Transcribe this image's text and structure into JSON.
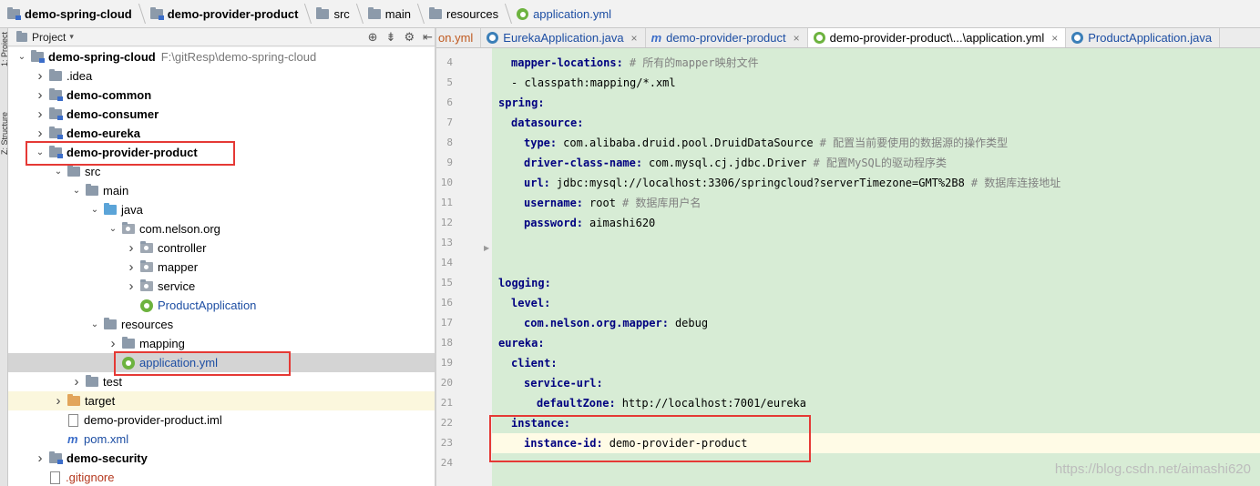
{
  "breadcrumb": [
    {
      "label": "demo-spring-cloud",
      "style": "bold"
    },
    {
      "label": "demo-provider-product",
      "style": "bold"
    },
    {
      "label": "src",
      "style": ""
    },
    {
      "label": "main",
      "style": ""
    },
    {
      "label": "resources",
      "style": ""
    },
    {
      "label": "application.yml",
      "style": "blue"
    }
  ],
  "tool_strip": {
    "project_tab": "1: Project",
    "structure_tab": "Z: Structure"
  },
  "project_panel": {
    "title": "Project"
  },
  "tree": [
    {
      "label": "demo-spring-cloud",
      "path": "F:\\gitResp\\demo-spring-cloud",
      "depth": 0,
      "expanded": true,
      "icon": "module-folder",
      "bold": true
    },
    {
      "label": ".idea",
      "depth": 1,
      "expanded": false,
      "icon": "folder"
    },
    {
      "label": "demo-common",
      "depth": 1,
      "expanded": false,
      "icon": "module-folder",
      "bold": true
    },
    {
      "label": "demo-consumer",
      "depth": 1,
      "expanded": false,
      "icon": "module-folder",
      "bold": true
    },
    {
      "label": "demo-eureka",
      "depth": 1,
      "expanded": false,
      "icon": "module-folder",
      "bold": true
    },
    {
      "label": "demo-provider-product",
      "depth": 1,
      "expanded": true,
      "icon": "module-folder",
      "bold": true
    },
    {
      "label": "src",
      "depth": 2,
      "expanded": true,
      "icon": "folder"
    },
    {
      "label": "main",
      "depth": 3,
      "expanded": true,
      "icon": "folder"
    },
    {
      "label": "java",
      "depth": 4,
      "expanded": true,
      "icon": "source-folder"
    },
    {
      "label": "com.nelson.org",
      "depth": 5,
      "expanded": true,
      "icon": "package"
    },
    {
      "label": "controller",
      "depth": 6,
      "expanded": false,
      "icon": "package"
    },
    {
      "label": "mapper",
      "depth": 6,
      "expanded": false,
      "icon": "package"
    },
    {
      "label": "service",
      "depth": 6,
      "expanded": false,
      "icon": "package"
    },
    {
      "label": "ProductApplication",
      "depth": 6,
      "icon": "spring-class",
      "color": "blue"
    },
    {
      "label": "resources",
      "depth": 4,
      "expanded": true,
      "icon": "folder"
    },
    {
      "label": "mapping",
      "depth": 5,
      "expanded": false,
      "icon": "folder"
    },
    {
      "label": "application.yml",
      "depth": 5,
      "icon": "spring-yml",
      "color": "blue",
      "selected": true
    },
    {
      "label": "test",
      "depth": 3,
      "expanded": false,
      "icon": "folder"
    },
    {
      "label": "target",
      "depth": 2,
      "expanded": false,
      "icon": "excluded-folder",
      "highlight": true
    },
    {
      "label": "demo-provider-product.iml",
      "depth": 2,
      "icon": "file"
    },
    {
      "label": "pom.xml",
      "depth": 2,
      "icon": "maven",
      "color": "blue"
    },
    {
      "label": "demo-security",
      "depth": 1,
      "expanded": false,
      "icon": "module-folder",
      "bold": true
    },
    {
      "label": ".gitignore",
      "depth": 1,
      "icon": "file",
      "color": "red"
    }
  ],
  "editor_tabs": [
    {
      "label": "on.yml",
      "icon": "",
      "cut": true
    },
    {
      "label": "EurekaApplication.java",
      "icon": "class",
      "close": "×"
    },
    {
      "label": "demo-provider-product",
      "icon": "maven",
      "close": "×"
    },
    {
      "label": "demo-provider-product\\...\\application.yml",
      "icon": "spring",
      "close": "×",
      "active": true
    },
    {
      "label": "ProductApplication.java",
      "icon": "class"
    }
  ],
  "code_lines": [
    {
      "num": "4",
      "indent": 1,
      "key": "mapper-locations:",
      "value": "",
      "comment": "# 所有的mapper映射文件"
    },
    {
      "num": "5",
      "indent": 1,
      "key": "",
      "value": "- classpath:mapping/*.xml",
      "comment": ""
    },
    {
      "num": "6",
      "indent": 0,
      "key": "spring:",
      "value": "",
      "comment": ""
    },
    {
      "num": "7",
      "indent": 1,
      "key": "datasource:",
      "value": "",
      "comment": ""
    },
    {
      "num": "8",
      "indent": 2,
      "key": "type:",
      "value": "com.alibaba.druid.pool.DruidDataSource",
      "comment": "# 配置当前要使用的数据源的操作类型"
    },
    {
      "num": "9",
      "indent": 2,
      "key": "driver-class-name:",
      "value": "com.mysql.cj.jdbc.Driver",
      "comment": "# 配置MySQL的驱动程序类"
    },
    {
      "num": "10",
      "indent": 2,
      "key": "url:",
      "value": "jdbc:mysql://localhost:3306/springcloud?serverTimezone=GMT%2B8",
      "comment": "# 数据库连接地址"
    },
    {
      "num": "11",
      "indent": 2,
      "key": "username:",
      "value": "root",
      "comment": "# 数据库用户名"
    },
    {
      "num": "12",
      "indent": 2,
      "key": "password:",
      "value": "aimashi620",
      "comment": ""
    },
    {
      "num": "13",
      "indent": 0,
      "key": "",
      "value": "",
      "comment": ""
    },
    {
      "num": "14",
      "indent": 0,
      "key": "",
      "value": "",
      "comment": ""
    },
    {
      "num": "15",
      "indent": 0,
      "key": "logging:",
      "value": "",
      "comment": ""
    },
    {
      "num": "16",
      "indent": 1,
      "key": "level:",
      "value": "",
      "comment": ""
    },
    {
      "num": "17",
      "indent": 2,
      "key": "com.nelson.org.mapper:",
      "value": "debug",
      "comment": ""
    },
    {
      "num": "18",
      "indent": 0,
      "key": "eureka:",
      "value": "",
      "comment": ""
    },
    {
      "num": "19",
      "indent": 1,
      "key": "client:",
      "value": "",
      "comment": ""
    },
    {
      "num": "20",
      "indent": 2,
      "key": "service-url:",
      "value": "",
      "comment": ""
    },
    {
      "num": "21",
      "indent": 3,
      "key": "defaultZone:",
      "value": "http://localhost:7001/eureka",
      "comment": ""
    },
    {
      "num": "22",
      "indent": 1,
      "key": "instance:",
      "value": "",
      "comment": ""
    },
    {
      "num": "23",
      "indent": 2,
      "key": "instance-id:",
      "value": "demo-provider-product",
      "comment": "",
      "current": true
    },
    {
      "num": "24",
      "indent": 0,
      "key": "",
      "value": "",
      "comment": ""
    }
  ],
  "watermark": "https://blog.csdn.net/aimashi620",
  "colors": {
    "code_bg": "#d7ecd5",
    "key": "#000080",
    "comment": "#808080",
    "annotation_box": "#e53935",
    "link": "#1d4ea3"
  }
}
